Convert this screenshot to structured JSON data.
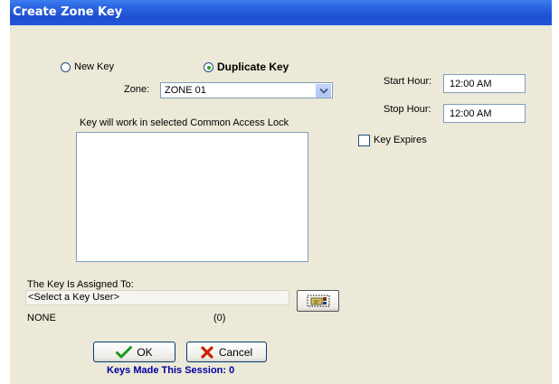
{
  "window": {
    "title": "Create Zone Key"
  },
  "key_type": {
    "new_key_label": "New Key",
    "duplicate_key_label": "Duplicate Key",
    "selected": "Duplicate Key"
  },
  "zone": {
    "label": "Zone:",
    "value": "ZONE 01"
  },
  "locks": {
    "label": "Key will work in selected Common Access Lock",
    "items": []
  },
  "schedule": {
    "start_label": "Start Hour:",
    "start_value": "12:00 AM",
    "stop_label": "Stop Hour:",
    "stop_value": "12:00 AM",
    "expires_label": "Key Expires",
    "expires_checked": false
  },
  "assignment": {
    "label": "The Key Is Assigned To:",
    "user_value": "<Select a Key User>",
    "name_value": "NONE",
    "count_value": "(0)"
  },
  "buttons": {
    "ok_label": "OK",
    "cancel_label": "Cancel"
  },
  "session": {
    "keys_made_text": "Keys Made This Session: 0"
  },
  "colors": {
    "title_bar": "#2a63e0",
    "dialog_bg": "#ece9d8",
    "session_text": "#0000a0",
    "ok_check": "#1a9a1a",
    "cancel_x": "#cc2200"
  }
}
